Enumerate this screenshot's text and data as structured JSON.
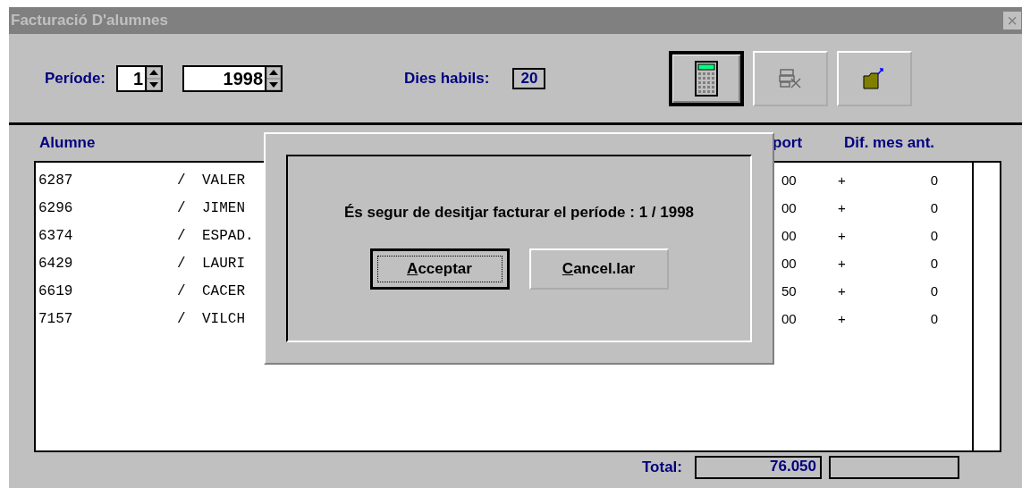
{
  "window": {
    "title": "Facturació D'alumnes",
    "active": false,
    "close": "×"
  },
  "toolbar": {
    "period_label": "Període:",
    "period_spinners": [
      {
        "value": "1"
      },
      {
        "value": "1998"
      }
    ],
    "working_days_label": "Dies habils:",
    "working_days": "20",
    "buttons": [
      {
        "kind": "calculator",
        "default": true,
        "disabled": false
      },
      {
        "kind": "grid-delete",
        "default": false,
        "disabled": true
      },
      {
        "kind": "folder",
        "default": false,
        "disabled": false
      }
    ]
  },
  "table": {
    "columns": [
      "Alumne",
      "port",
      "Dif. mes ant."
    ],
    "rows": [
      {
        "id": "6287",
        "sep": "/",
        "name": "VALER",
        "amount": "00",
        "sign": "+",
        "diff": "0"
      },
      {
        "id": "6296",
        "sep": "/",
        "name": "JIMEN",
        "amount": "00",
        "sign": "+",
        "diff": "0"
      },
      {
        "id": "6374",
        "sep": "/",
        "name": "ESPAD.",
        "amount": "00",
        "sign": "+",
        "diff": "0"
      },
      {
        "id": "6429",
        "sep": "/",
        "name": "LAURI",
        "amount": "00",
        "sign": "+",
        "diff": "0"
      },
      {
        "id": "6619",
        "sep": "/",
        "name": "CACER",
        "amount": "50",
        "sign": "+",
        "diff": "0"
      },
      {
        "id": "7157",
        "sep": "/",
        "name": "VILCH",
        "amount": "00",
        "sign": "+",
        "diff": "0"
      }
    ]
  },
  "footer": {
    "total_label": "Total:",
    "total": "76.050"
  },
  "dialog": {
    "message": "És segur de desitjar facturar el període : 1 / 1998",
    "buttons": [
      {
        "label": "Acceptar",
        "default": true
      },
      {
        "label": "Cancel.lar",
        "default": false
      }
    ]
  }
}
